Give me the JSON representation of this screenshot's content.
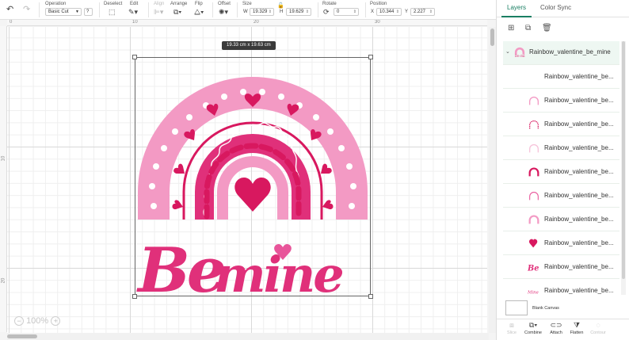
{
  "toolbar": {
    "operation_label": "Operation",
    "operation_value": "Basic Cut",
    "deselect_label": "Deselect",
    "edit_label": "Edit",
    "align_label": "Align",
    "arrange_label": "Arrange",
    "flip_label": "Flip",
    "offset_label": "Offset",
    "size_label": "Size",
    "width_letter": "W",
    "width_value": "19.329",
    "height_letter": "H",
    "height_value": "19.629",
    "rotate_label": "Rotate",
    "rotate_value": "0",
    "position_label": "Position",
    "x_letter": "X",
    "x_value": "10.344",
    "y_letter": "Y",
    "y_value": "2.227"
  },
  "canvas": {
    "ruler_top": [
      "0",
      "10",
      "20",
      "30"
    ],
    "ruler_left": [
      "10",
      "20"
    ],
    "dimension_tag": "19.33  cm x 19.63  cm",
    "zoom_level": "100%",
    "artwork": {
      "line1": "Be",
      "line2": "mine",
      "colors": {
        "light_pink": "#f39ac4",
        "mid_pink": "#e8559a",
        "dark_pink": "#d8185f",
        "hot_pink": "#e0307a"
      }
    }
  },
  "panel": {
    "tabs": [
      "Layers",
      "Color Sync"
    ],
    "active_tab": "Layers",
    "group_name": "Rainbow_valentine_be_mine",
    "layers": [
      {
        "name": "Rainbow_valentine_be...",
        "thumb": "blank"
      },
      {
        "name": "Rainbow_valentine_be...",
        "thumb": "arc-light"
      },
      {
        "name": "Rainbow_valentine_be...",
        "thumb": "arc-dashed"
      },
      {
        "name": "Rainbow_valentine_be...",
        "thumb": "arc-faint"
      },
      {
        "name": "Rainbow_valentine_be...",
        "thumb": "arc-dark"
      },
      {
        "name": "Rainbow_valentine_be...",
        "thumb": "arc-mid"
      },
      {
        "name": "Rainbow_valentine_be...",
        "thumb": "arc-pink"
      },
      {
        "name": "Rainbow_valentine_be...",
        "thumb": "heart"
      },
      {
        "name": "Rainbow_valentine_be...",
        "thumb": "be-text"
      },
      {
        "name": "Rainbow_valentine_be...",
        "thumb": "mine-text"
      }
    ],
    "blank_canvas_label": "Blank Canvas",
    "bottom_actions": [
      {
        "label": "Slice",
        "enabled": false
      },
      {
        "label": "Combine",
        "enabled": true
      },
      {
        "label": "Attach",
        "enabled": true
      },
      {
        "label": "Flatten",
        "enabled": true
      },
      {
        "label": "Contour",
        "enabled": false
      }
    ]
  }
}
